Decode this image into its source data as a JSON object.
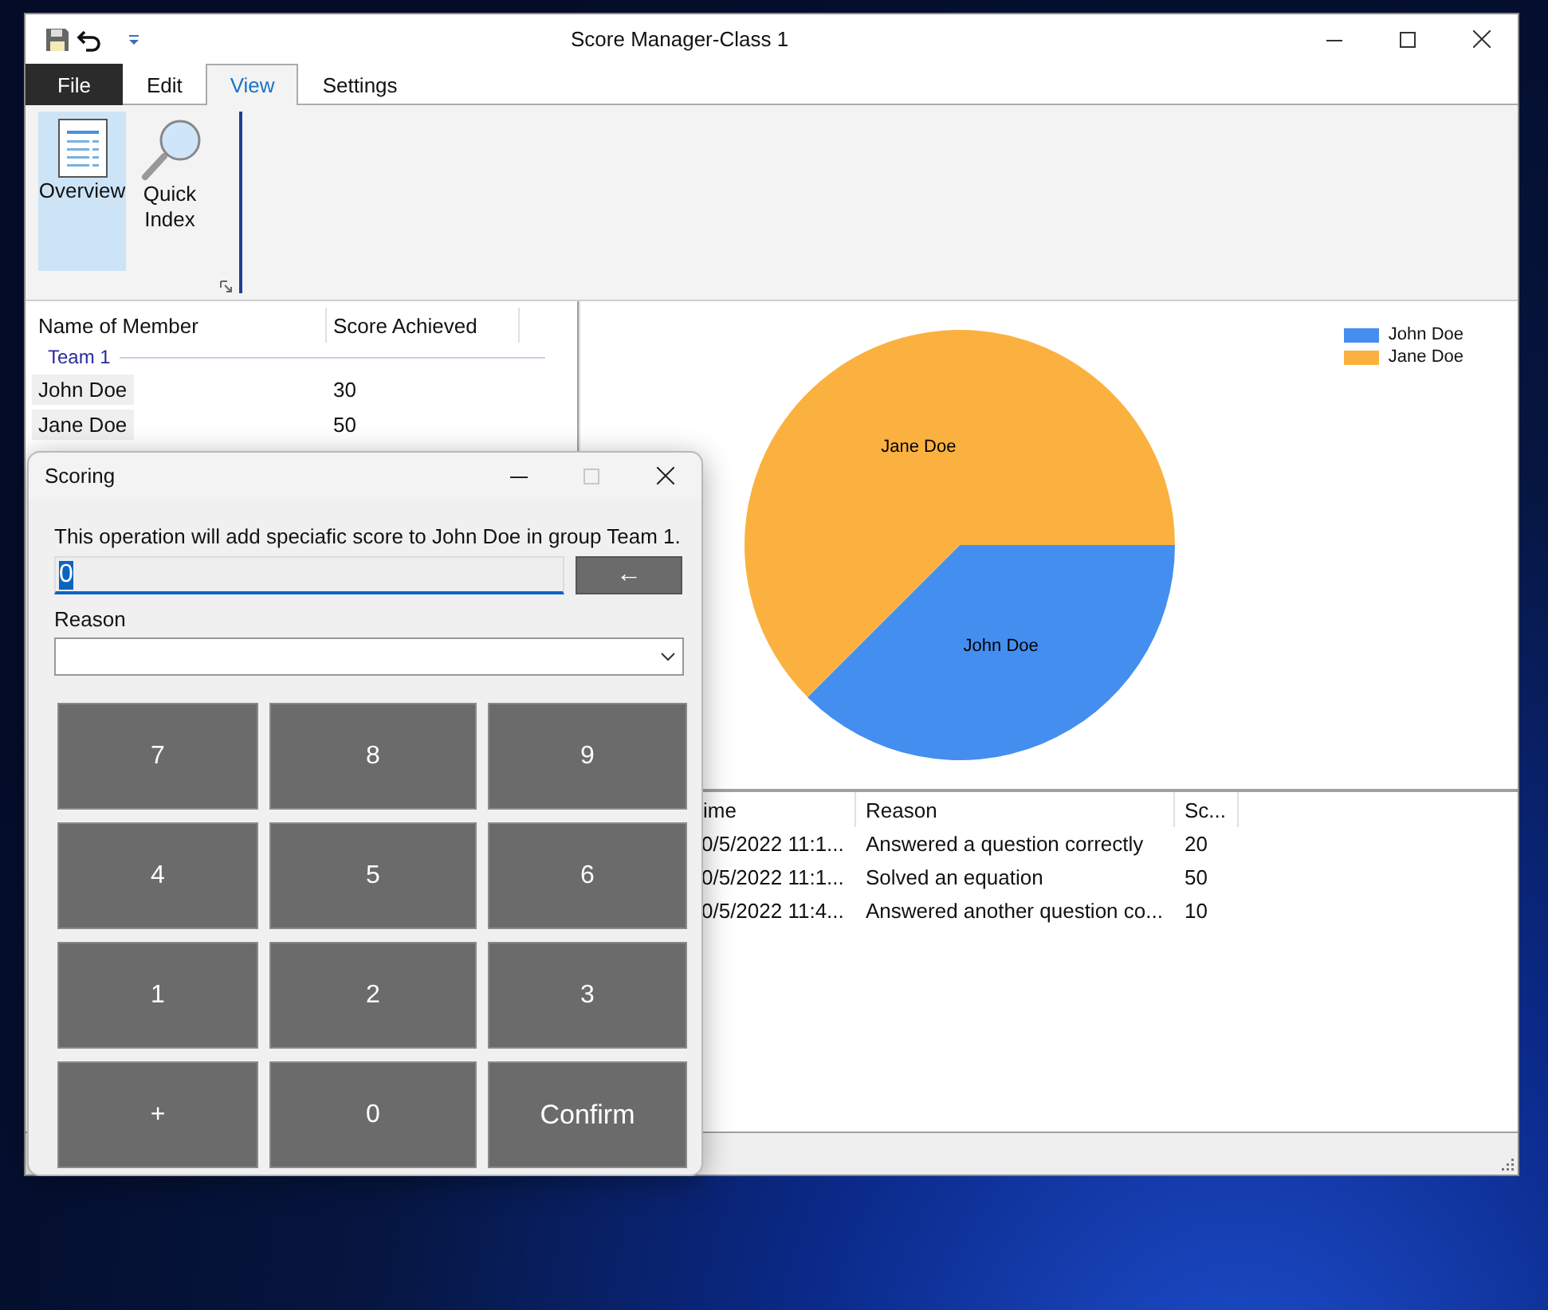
{
  "window": {
    "title": "Score Manager-Class 1"
  },
  "menu_tabs": [
    {
      "label": "File",
      "kind": "file",
      "selected": false
    },
    {
      "label": "Edit",
      "kind": "tab",
      "selected": false
    },
    {
      "label": "View",
      "kind": "tab",
      "selected": true
    },
    {
      "label": "Settings",
      "kind": "tab",
      "selected": false
    }
  ],
  "ribbon": {
    "buttons": [
      {
        "label": "Overview",
        "kind": "document",
        "selected": true
      },
      {
        "label": "Quick Index",
        "kind": "magnifier",
        "selected": false
      }
    ]
  },
  "members_table": {
    "columns": [
      "Name of Member",
      "Score Achieved"
    ],
    "groups": [
      {
        "name": "Team 1",
        "rows": [
          {
            "name": "John Doe",
            "score": "30"
          },
          {
            "name": "Jane Doe",
            "score": "50"
          }
        ]
      }
    ]
  },
  "chart": {
    "chart_data": {
      "type": "pie",
      "categories": [
        "John Doe",
        "Jane Doe"
      ],
      "values": [
        37.5,
        62.5
      ]
    },
    "legend": [
      {
        "label": "John Doe",
        "color": "#448ef0"
      },
      {
        "label": "Jane Doe",
        "color": "#fbb140"
      }
    ]
  },
  "history_table": {
    "columns": [
      "ime",
      "Reason",
      "Sc..."
    ],
    "rows": [
      {
        "column_1": "0/5/2022 11:1...",
        "reason": "Answered a question correctly",
        "score": "20"
      },
      {
        "column_1": "0/5/2022 11:1...",
        "reason": "Solved an equation",
        "score": "50"
      },
      {
        "column_1": "0/5/2022 11:4...",
        "reason": "Answered another question co...",
        "score": "10"
      }
    ]
  },
  "dialog": {
    "title": "Scoring",
    "maximize_disabled": true,
    "message": "This operation will add speciafic score to John Doe in group Team 1.",
    "score_field": {
      "value": "0",
      "value_selected": true
    },
    "backspace": "←",
    "reason_label": "Reason",
    "keys": [
      {
        "label": "7",
        "kind": "key"
      },
      {
        "label": "8",
        "kind": "key"
      },
      {
        "label": "9",
        "kind": "key"
      },
      {
        "label": "4",
        "kind": "key"
      },
      {
        "label": "5",
        "kind": "key"
      },
      {
        "label": "6",
        "kind": "key"
      },
      {
        "label": "1",
        "kind": "key"
      },
      {
        "label": "2",
        "kind": "key"
      },
      {
        "label": "3",
        "kind": "key"
      },
      {
        "label": "+",
        "kind": "key"
      },
      {
        "label": "0",
        "kind": "key"
      },
      {
        "label": "Confirm",
        "kind": "confirm"
      }
    ]
  }
}
